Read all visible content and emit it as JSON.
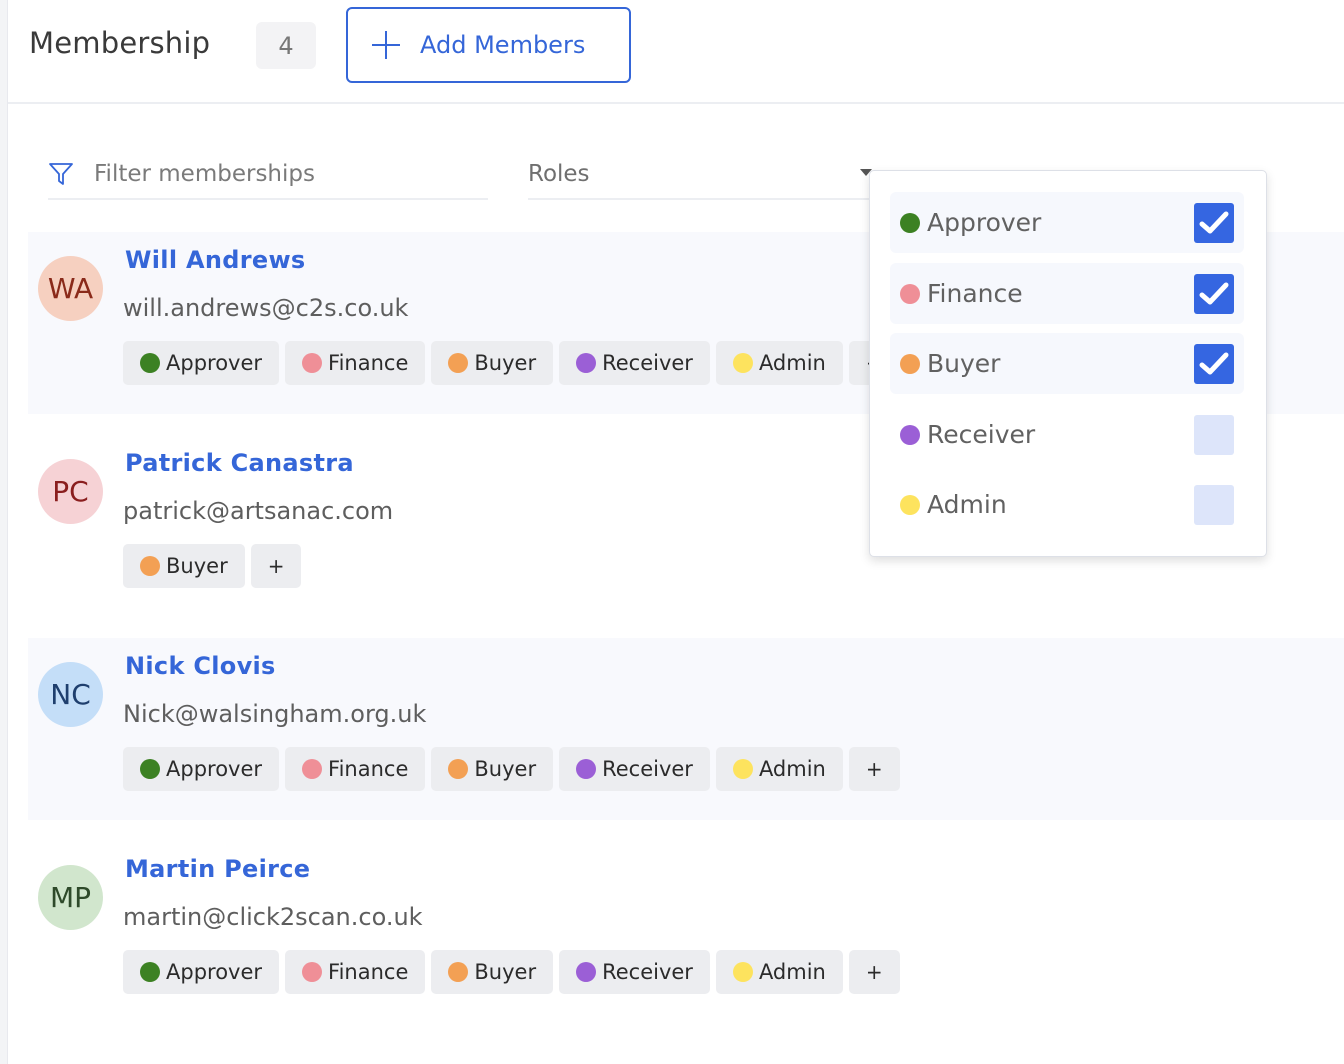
{
  "header": {
    "title": "Membership",
    "count": "4",
    "add_button_label": "Add Members"
  },
  "filters": {
    "search_placeholder": "Filter memberships",
    "search_value": "",
    "roles_label": "Roles"
  },
  "role_colors": {
    "Approver": "#3c8123",
    "Finance": "#ef8f97",
    "Buyer": "#f3a054",
    "Receiver": "#9b5fd6",
    "Admin": "#fde35e"
  },
  "roles_dropdown": {
    "options": [
      {
        "label": "Approver",
        "color": "#3c8123",
        "checked": true
      },
      {
        "label": "Finance",
        "color": "#ef8f97",
        "checked": true
      },
      {
        "label": "Buyer",
        "color": "#f3a054",
        "checked": true
      },
      {
        "label": "Receiver",
        "color": "#9b5fd6",
        "checked": false
      },
      {
        "label": "Admin",
        "color": "#fde35e",
        "checked": false
      }
    ]
  },
  "members": [
    {
      "initials": "WA",
      "name": "Will Andrews",
      "email": "will.andrews@c2s.co.uk",
      "avatar_bg": "#f6d0c0",
      "avatar_fg": "#8a2a1a",
      "roles": [
        {
          "label": "Approver",
          "color": "#3c8123"
        },
        {
          "label": "Finance",
          "color": "#ef8f97"
        },
        {
          "label": "Buyer",
          "color": "#f3a054"
        },
        {
          "label": "Receiver",
          "color": "#9b5fd6"
        },
        {
          "label": "Admin",
          "color": "#fde35e"
        }
      ],
      "add_role_label": "+"
    },
    {
      "initials": "PC",
      "name": "Patrick Canastra",
      "email": "patrick@artsanac.com",
      "avatar_bg": "#f6d2d5",
      "avatar_fg": "#8a1e1e",
      "roles": [
        {
          "label": "Buyer",
          "color": "#f3a054"
        }
      ],
      "add_role_label": "+"
    },
    {
      "initials": "NC",
      "name": "Nick Clovis",
      "email": "Nick@walsingham.org.uk",
      "avatar_bg": "#c4def8",
      "avatar_fg": "#1f3f6e",
      "roles": [
        {
          "label": "Approver",
          "color": "#3c8123"
        },
        {
          "label": "Finance",
          "color": "#ef8f97"
        },
        {
          "label": "Buyer",
          "color": "#f3a054"
        },
        {
          "label": "Receiver",
          "color": "#9b5fd6"
        },
        {
          "label": "Admin",
          "color": "#fde35e"
        }
      ],
      "add_role_label": "+"
    },
    {
      "initials": "MP",
      "name": "Martin Peirce",
      "email": "martin@click2scan.co.uk",
      "avatar_bg": "#d1e6cd",
      "avatar_fg": "#2e4a2a",
      "roles": [
        {
          "label": "Approver",
          "color": "#3c8123"
        },
        {
          "label": "Finance",
          "color": "#ef8f97"
        },
        {
          "label": "Buyer",
          "color": "#f3a054"
        },
        {
          "label": "Receiver",
          "color": "#9b5fd6"
        },
        {
          "label": "Admin",
          "color": "#fde35e"
        }
      ],
      "add_role_label": "+"
    }
  ]
}
